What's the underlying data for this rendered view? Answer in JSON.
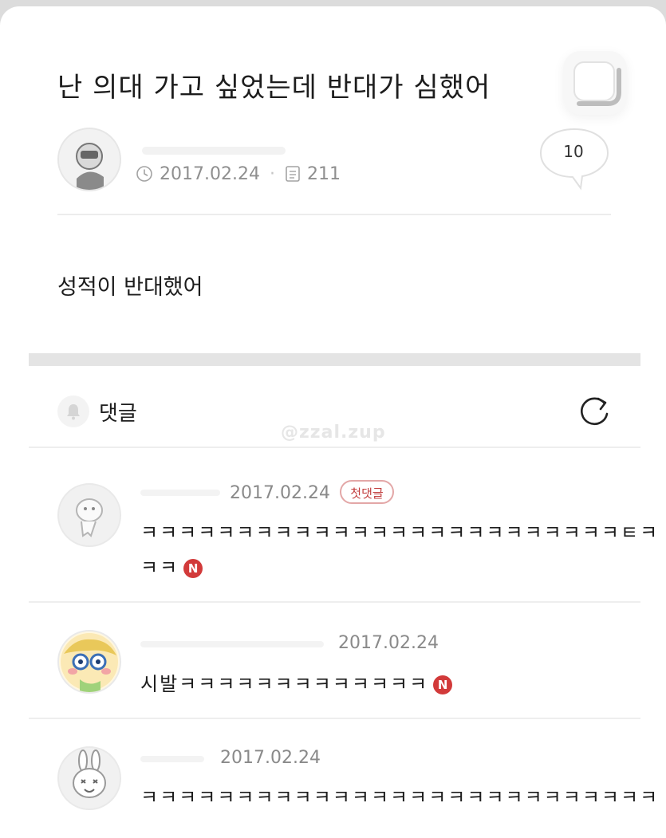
{
  "post": {
    "title": "난 의대 가고 싶었는데 반대가 심했어",
    "date": "2017.02.24",
    "views": "211",
    "comment_count": "10",
    "body": "성적이 반대했어"
  },
  "icons": {
    "clock": "clock-icon",
    "views": "document-icon",
    "bell": "bell-icon",
    "refresh": "refresh-icon",
    "bookmark": "scrap-icon",
    "comment": "speech-bubble-icon"
  },
  "comments_section": {
    "label": "댓글",
    "watermark": "@zzal.zup"
  },
  "comments": [
    {
      "date": "2017.02.24",
      "badge": "첫댓글",
      "line1": "ㅋㅋㅋㅋㅋㅋㅋㅋㅋㅋㅋㅋㅋㅋㅋㅋㅋㅋㅋㅋㅋㅋㅋㅋㅋㅌㅋ",
      "line2": "ㅋㅋ",
      "new_badge": "N"
    },
    {
      "date": "2017.02.24",
      "line1": "시발ㅋㅋㅋㅋㅋㅋㅋㅋㅋㅋㅋㅋㅋ",
      "new_badge": "N"
    },
    {
      "date": "2017.02.24",
      "line1": "ㅋㅋㅋㅋㅋㅋㅋㅋㅋㅋㅋㅋㅋㅋㅋㅋㅋㅋㅋㅋㅋㅋㅋㅋㅋㅋㅋ"
    }
  ],
  "colors": {
    "accent_red": "#d23a3a",
    "badge_border": "#e3a7a7",
    "meta_gray": "#8f8f8f"
  }
}
